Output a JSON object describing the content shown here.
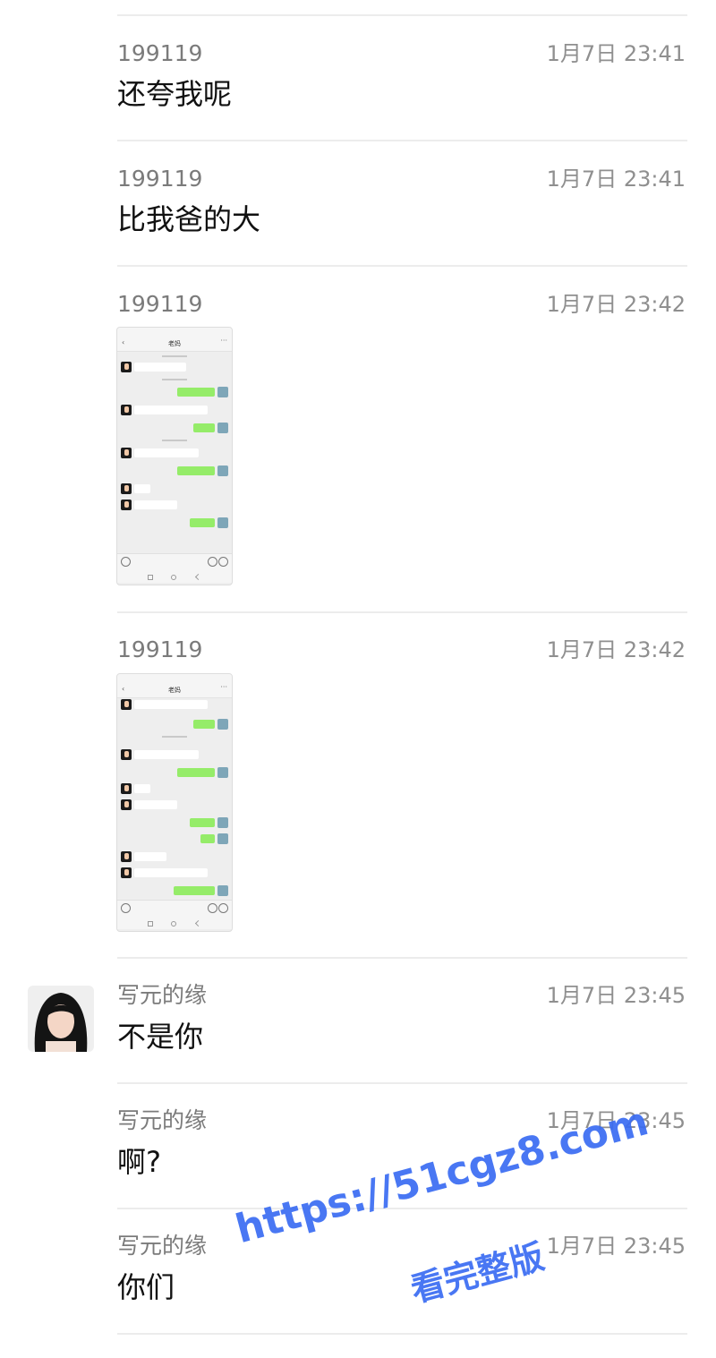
{
  "messages": [
    {
      "sender": "199119",
      "time": "1月7日 23:41",
      "text": "还夸我呢"
    },
    {
      "sender": "199119",
      "time": "1月7日 23:41",
      "text": "比我爸的大"
    },
    {
      "sender": "199119",
      "time": "1月7日 23:42",
      "image": "chat-screenshot"
    },
    {
      "sender": "199119",
      "time": "1月7日 23:42",
      "image": "chat-screenshot"
    },
    {
      "sender": "写元的缘",
      "time": "1月7日 23:45",
      "text": "不是你"
    },
    {
      "sender": "写元的缘",
      "time": "1月7日 23:45",
      "text": "啊?"
    },
    {
      "sender": "写元的缘",
      "time": "1月7日 23:45",
      "text": "你们"
    }
  ],
  "screenshot": {
    "title": "老妈"
  },
  "watermark": {
    "url": "https://51cgz8.com",
    "text": "看完整版",
    "color": "#3a6cf2"
  }
}
